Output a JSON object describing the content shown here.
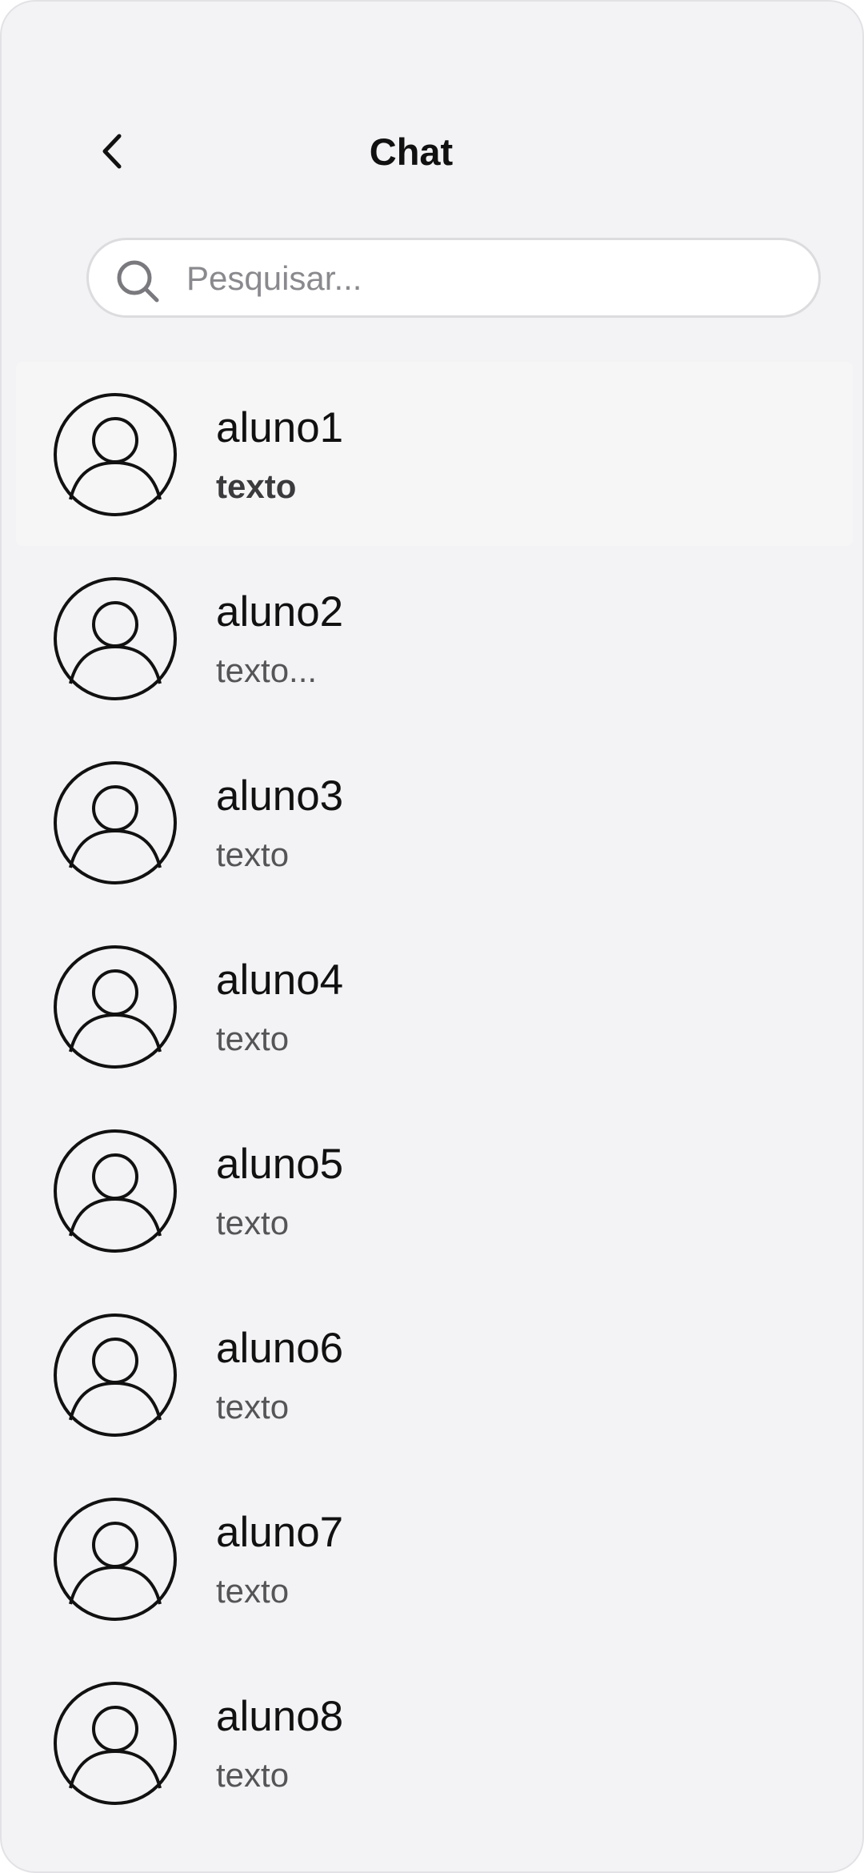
{
  "header": {
    "title": "Chat",
    "back_icon": "chevron-left-icon"
  },
  "search": {
    "placeholder": "Pesquisar...",
    "value": "",
    "icon": "search-icon"
  },
  "chats": [
    {
      "name": "aluno1",
      "preview": "texto",
      "selected": true,
      "avatar_icon": "user-avatar-icon"
    },
    {
      "name": "aluno2",
      "preview": "texto...",
      "selected": false,
      "avatar_icon": "user-avatar-icon"
    },
    {
      "name": "aluno3",
      "preview": "texto",
      "selected": false,
      "avatar_icon": "user-avatar-icon"
    },
    {
      "name": "aluno4",
      "preview": "texto",
      "selected": false,
      "avatar_icon": "user-avatar-icon"
    },
    {
      "name": "aluno5",
      "preview": "texto",
      "selected": false,
      "avatar_icon": "user-avatar-icon"
    },
    {
      "name": "aluno6",
      "preview": "texto",
      "selected": false,
      "avatar_icon": "user-avatar-icon"
    },
    {
      "name": "aluno7",
      "preview": "texto",
      "selected": false,
      "avatar_icon": "user-avatar-icon"
    },
    {
      "name": "aluno8",
      "preview": "texto",
      "selected": false,
      "avatar_icon": "user-avatar-icon"
    }
  ],
  "colors": {
    "background": "#f3f3f5",
    "selected_row": "#f6f6f7",
    "text_primary": "#111111",
    "text_secondary": "#555558"
  }
}
